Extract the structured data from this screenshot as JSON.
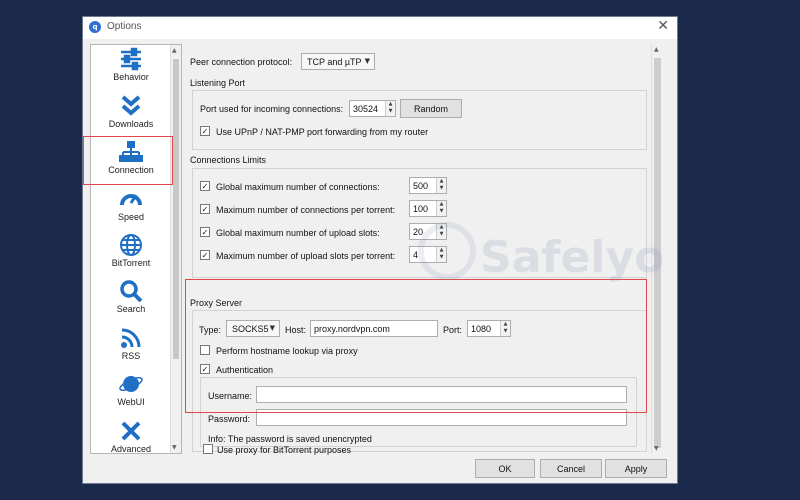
{
  "window": {
    "title": "Options",
    "icon_glyph": "q"
  },
  "sidebar": {
    "items": [
      {
        "label": "Behavior",
        "icon": "sliders-icon"
      },
      {
        "label": "Downloads",
        "icon": "double-chevron-down-icon"
      },
      {
        "label": "Connection",
        "icon": "network-icon"
      },
      {
        "label": "Speed",
        "icon": "gauge-icon"
      },
      {
        "label": "BitTorrent",
        "icon": "globe-icon"
      },
      {
        "label": "Search",
        "icon": "magnifier-icon"
      },
      {
        "label": "RSS",
        "icon": "rss-icon"
      },
      {
        "label": "WebUI",
        "icon": "planet-icon"
      },
      {
        "label": "Advanced",
        "icon": "tools-icon"
      }
    ],
    "selected": "Connection"
  },
  "connection": {
    "protocol_label": "Peer connection protocol:",
    "protocol_value": "TCP and µTP",
    "listening_port": {
      "title": "Listening Port",
      "port_label": "Port used for incoming connections:",
      "port_value": "30524",
      "random_label": "Random",
      "upnp_label": "Use UPnP / NAT-PMP port forwarding from my router",
      "upnp_checked": true
    },
    "limits": {
      "title": "Connections Limits",
      "rows": [
        {
          "label": "Global maximum number of connections:",
          "value": "500",
          "checked": true
        },
        {
          "label": "Maximum number of connections per torrent:",
          "value": "100",
          "checked": true
        },
        {
          "label": "Global maximum number of upload slots:",
          "value": "20",
          "checked": true
        },
        {
          "label": "Maximum number of upload slots per torrent:",
          "value": "4",
          "checked": true
        }
      ]
    },
    "proxy": {
      "title": "Proxy Server",
      "type_label": "Type:",
      "type_value": "SOCKS5",
      "host_label": "Host:",
      "host_value": "proxy.nordvpn.com",
      "port_label": "Port:",
      "port_value": "1080",
      "hostname_lookup_label": "Perform hostname lookup via proxy",
      "hostname_lookup_checked": false,
      "auth_label": "Authentication",
      "auth_checked": true,
      "username_label": "Username:",
      "username_value": "",
      "password_label": "Password:",
      "password_value": "",
      "info_text": "Info: The password is saved unencrypted",
      "bittorrent_label": "Use proxy for BitTorrent purposes",
      "bittorrent_checked": false
    }
  },
  "footer": {
    "ok_label": "OK",
    "cancel_label": "Cancel",
    "apply_label": "Apply"
  },
  "watermark_text": "Safelyo",
  "colors": {
    "highlight": "#e0474c",
    "icon_blue": "#1f6fc5",
    "background": "#1b2a4a"
  }
}
